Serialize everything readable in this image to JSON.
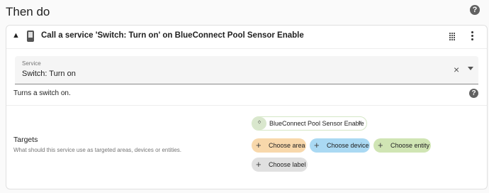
{
  "section": {
    "title": "Then do"
  },
  "action": {
    "header_title": "Call a service 'Switch: Turn on' on BlueConnect Pool Sensor Enable",
    "service_label": "Service",
    "service_value": "Switch: Turn on",
    "description": "Turns a switch on.",
    "targets_label": "Targets",
    "targets_description": "What should this service use as targeted areas, devices or entities.",
    "selected_entity": "BlueConnect Pool Sensor Enable",
    "add_buttons": {
      "area": "Choose area",
      "device": "Choose device",
      "entity": "Choose entity",
      "label": "Choose label"
    }
  },
  "icons": {
    "help": "?",
    "collapse": "chevron-up-icon",
    "device": "phone-icon",
    "drag": "drag-handle-icon",
    "menu": "more-vert-icon",
    "clear": "×",
    "bluetooth": "bluetooth-icon",
    "plus": "+"
  },
  "colors": {
    "area_chip": "#f8d8ab",
    "device_chip": "#aad9f3",
    "entity_chip": "#d0e5b4",
    "label_chip": "#e0e0e0"
  }
}
